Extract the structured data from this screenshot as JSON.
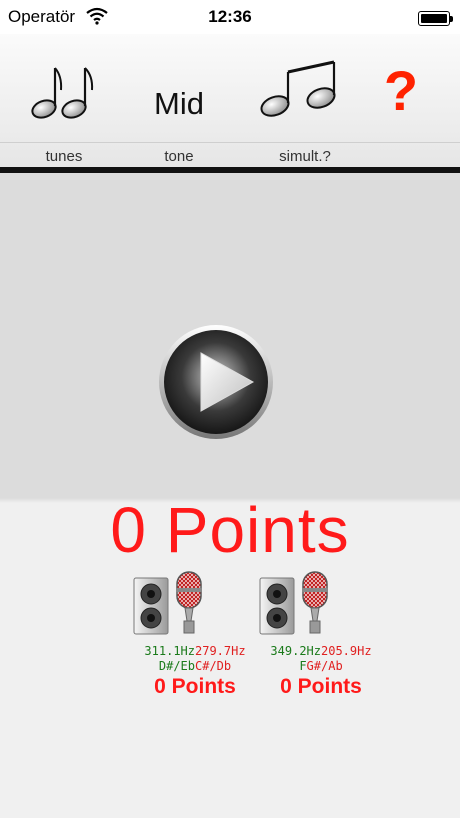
{
  "status_bar": {
    "carrier": "Operatör",
    "time": "12:36"
  },
  "toolbar": {
    "tunes_label": "tunes",
    "tone_value": "Mid",
    "tone_label": "tone",
    "simult_label": "simult.?",
    "help_glyph": "?"
  },
  "main": {
    "total_points": "0 Points",
    "players": [
      {
        "freq_played": "311.1Hz",
        "freq_sung": "279.7Hz",
        "note_played": "D#/Eb",
        "note_sung": "C#/Db",
        "points": "0 Points"
      },
      {
        "freq_played": "349.2Hz",
        "freq_sung": "205.9Hz",
        "note_played": "F",
        "note_sung": "G#/Ab",
        "points": "0 Points"
      }
    ]
  },
  "colors": {
    "points_red": "#ff1a1a",
    "freq_green": "#1a7a1a",
    "help_red": "#ff2200"
  }
}
